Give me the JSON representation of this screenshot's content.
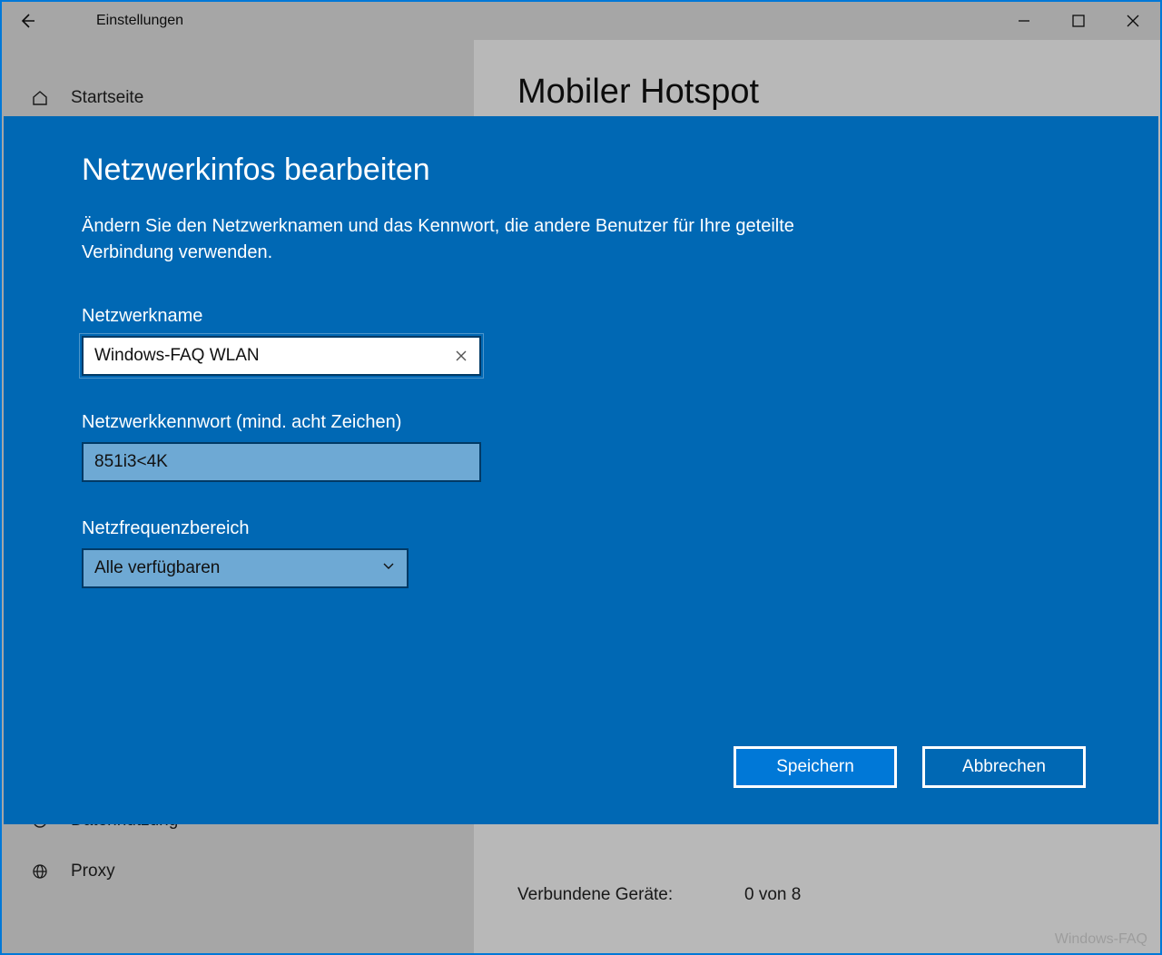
{
  "titlebar": {
    "title": "Einstellungen"
  },
  "sidebar": {
    "home": "Startseite",
    "data_usage": "Datennutzung",
    "proxy": "Proxy"
  },
  "main": {
    "title": "Mobiler Hotspot",
    "connected_label": "Verbundene Geräte:",
    "connected_value": "0 von 8"
  },
  "modal": {
    "title": "Netzwerkinfos bearbeiten",
    "description": "Ändern Sie den Netzwerknamen und das Kennwort, die andere Benutzer für Ihre geteilte Verbindung verwenden.",
    "network_name_label": "Netzwerkname",
    "network_name_value": "Windows-FAQ WLAN",
    "password_label": "Netzwerkkennwort (mind. acht Zeichen)",
    "password_value": "851i3<4K",
    "band_label": "Netzfrequenzbereich",
    "band_value": "Alle verfügbaren",
    "save": "Speichern",
    "cancel": "Abbrechen"
  },
  "watermark": "Windows-FAQ"
}
